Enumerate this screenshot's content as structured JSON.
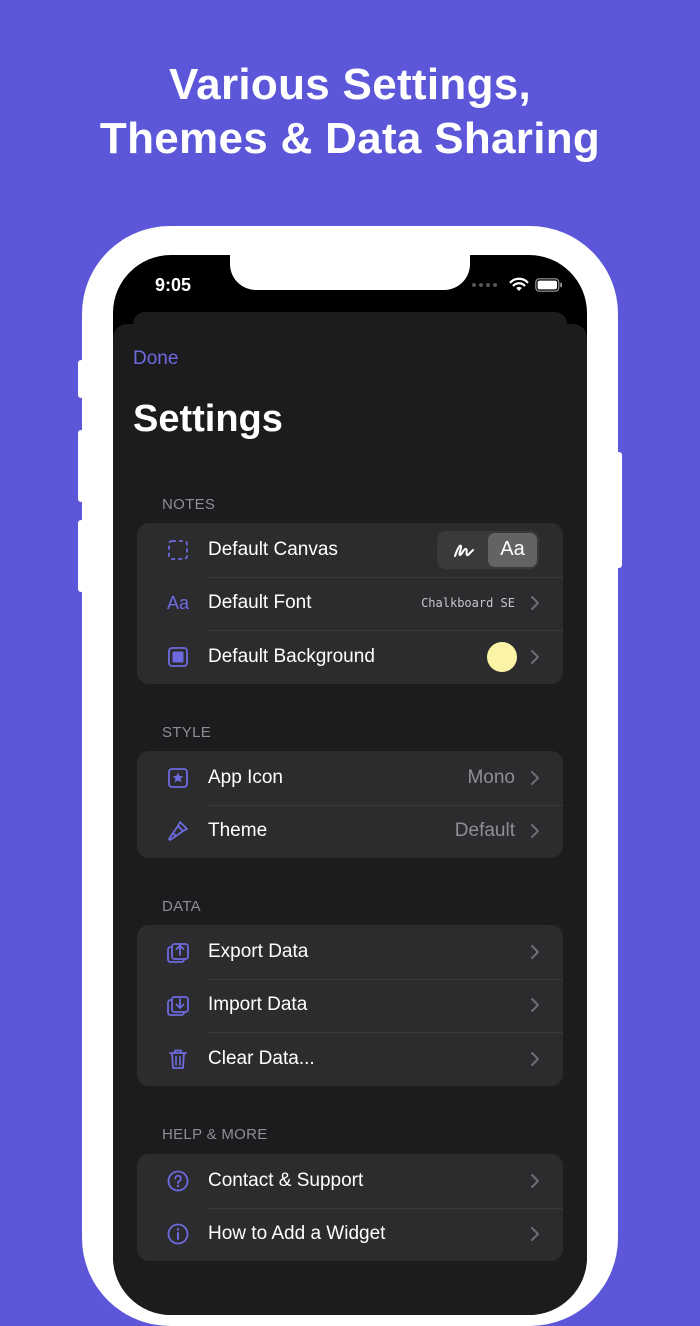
{
  "headline": {
    "line1": "Various Settings,",
    "line2": "Themes & Data Sharing"
  },
  "colors": {
    "background": "#5b57d8",
    "accent": "#6d6ae0",
    "sheet": "#1c1c1e",
    "group": "#2c2c2e",
    "swatch": "#fbf4a6"
  },
  "status_bar": {
    "time": "9:05",
    "icons": [
      "cellular-dots-icon",
      "wifi-icon",
      "battery-icon"
    ]
  },
  "nav": {
    "done_label": "Done",
    "title": "Settings"
  },
  "sections": {
    "notes": {
      "header": "NOTES",
      "default_canvas": {
        "label": "Default Canvas",
        "icon": "dashed-square-icon",
        "segments": [
          {
            "icon": "scribble-icon"
          },
          {
            "label": "Aa",
            "selected": true
          }
        ]
      },
      "default_font": {
        "label": "Default Font",
        "icon": "font-icon",
        "icon_text": "Aa",
        "value": "Chalkboard SE"
      },
      "default_background": {
        "label": "Default Background",
        "icon": "filled-square-icon"
      }
    },
    "style": {
      "header": "STYLE",
      "app_icon": {
        "label": "App Icon",
        "icon": "star-square-icon",
        "value": "Mono"
      },
      "theme": {
        "label": "Theme",
        "icon": "paintbrush-icon",
        "value": "Default"
      }
    },
    "data": {
      "header": "DATA",
      "export": {
        "label": "Export Data",
        "icon": "export-icon"
      },
      "import": {
        "label": "Import Data",
        "icon": "import-icon"
      },
      "clear": {
        "label": "Clear Data...",
        "icon": "trash-icon"
      }
    },
    "help": {
      "header": "HELP & MORE",
      "contact": {
        "label": "Contact & Support",
        "icon": "question-circle-icon"
      },
      "widget": {
        "label": "How to Add a Widget",
        "icon": "info-circle-icon"
      }
    }
  }
}
